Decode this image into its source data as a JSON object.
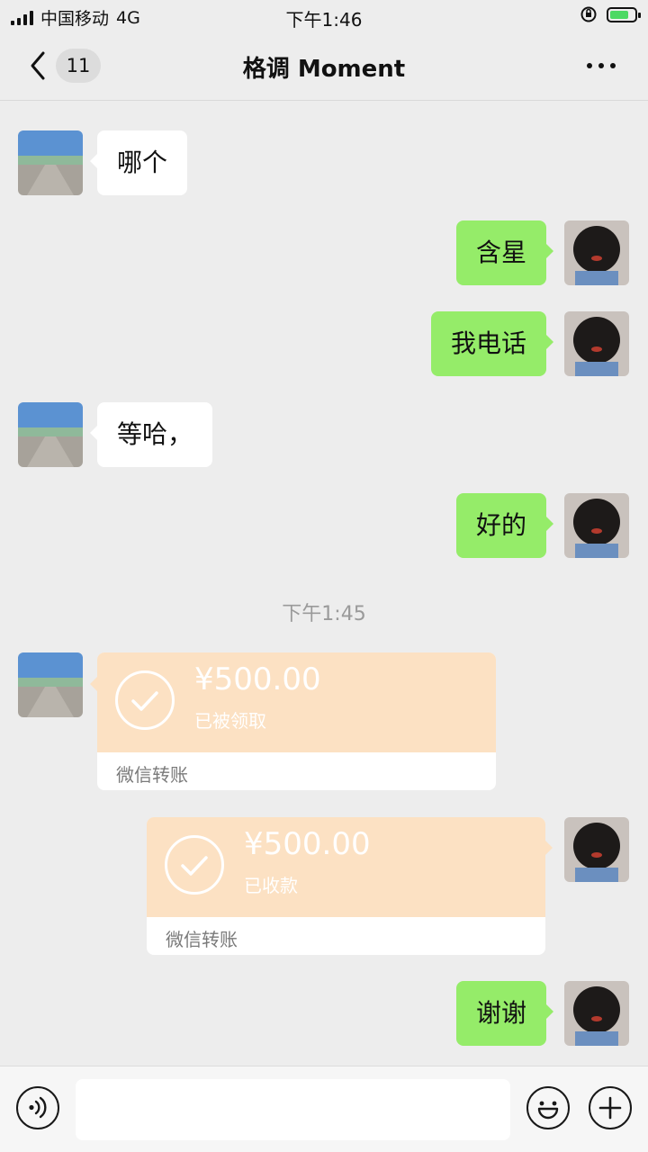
{
  "status_bar": {
    "carrier": "中国移动",
    "network": "4G",
    "time": "下午1:46"
  },
  "nav": {
    "unread_count": "11",
    "title": "格调 Moment"
  },
  "messages": [
    {
      "side": "left",
      "text": "哪个"
    },
    {
      "side": "right",
      "text": "含星"
    },
    {
      "side": "right",
      "text": "我电话"
    },
    {
      "side": "left",
      "text": "等哈，"
    },
    {
      "side": "right",
      "text": "好的"
    }
  ],
  "timestamp": "下午1:45",
  "transfers": [
    {
      "side": "left",
      "amount": "¥500.00",
      "status": "已被领取",
      "footer": "微信转账"
    },
    {
      "side": "right",
      "amount": "¥500.00",
      "status": "已收款",
      "footer": "微信转账"
    }
  ],
  "last_message": {
    "side": "right",
    "text": "谢谢"
  },
  "colors": {
    "background": "#ededed",
    "sent_bubble": "#95ec69",
    "received_bubble": "#ffffff",
    "transfer_card": "#fce1c3",
    "timestamp_text": "#9a9a9a"
  },
  "icons": {
    "back": "chevron-left-icon",
    "more": "more-dots-icon",
    "voice": "voice-icon",
    "emoji": "emoji-icon",
    "plus": "plus-icon",
    "transfer": "check-circle-icon"
  }
}
